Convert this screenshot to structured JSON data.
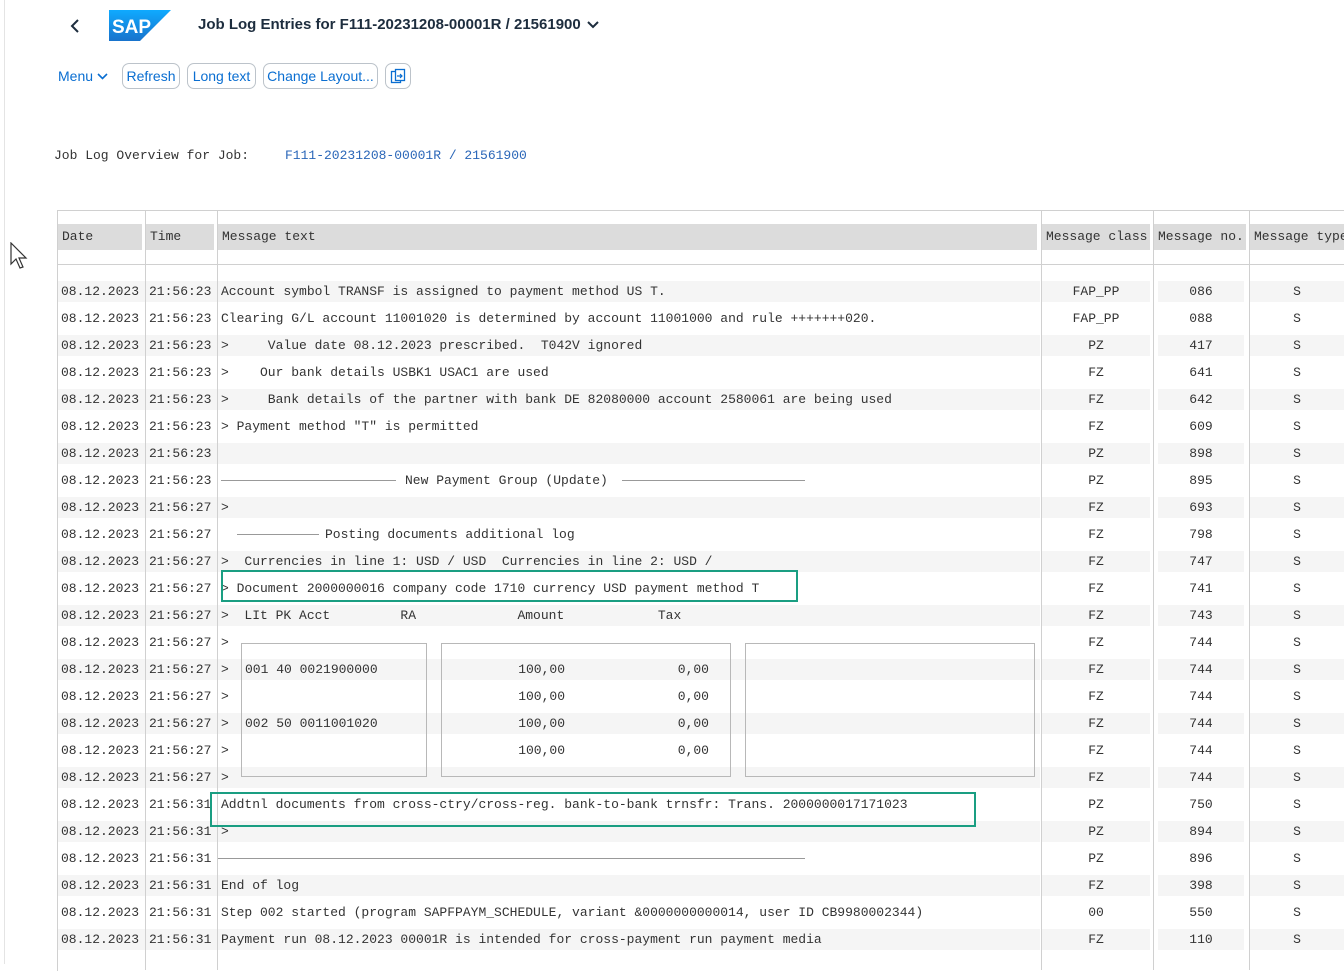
{
  "header": {
    "title": "Job Log Entries for F111-20231208-00001R / 21561900",
    "logo_text": "SAP"
  },
  "toolbar": {
    "menu_label": "Menu",
    "refresh_label": "Refresh",
    "long_text_label": "Long text",
    "change_layout_label": "Change Layout...",
    "export_icon": "share-icon"
  },
  "overview": {
    "label": "Job Log Overview for Job:",
    "value": "F111-20231208-00001R / 21561900"
  },
  "columns": [
    "Date",
    "Time",
    "Message text",
    "Message class",
    "Message no.",
    "Message type"
  ],
  "rows": [
    {
      "date": "08.12.2023",
      "time": "21:56:23",
      "text": "Account symbol TRANSF is assigned to payment method US T.",
      "cls": "FAP_PP",
      "no": "086",
      "type": "S"
    },
    {
      "date": "08.12.2023",
      "time": "21:56:23",
      "text": "Clearing G/L account 11001020 is determined by account 11001000 and rule +++++++020.",
      "cls": "FAP_PP",
      "no": "088",
      "type": "S"
    },
    {
      "date": "08.12.2023",
      "time": "21:56:23",
      "text": ">     Value date 08.12.2023 prescribed.  T042V ignored",
      "cls": "PZ",
      "no": "417",
      "type": "S"
    },
    {
      "date": "08.12.2023",
      "time": "21:56:23",
      "text": ">    Our bank details USBK1 USAC1 are used",
      "cls": "FZ",
      "no": "641",
      "type": "S"
    },
    {
      "date": "08.12.2023",
      "time": "21:56:23",
      "text": ">     Bank details of the partner with bank DE 82080000 account 2580061 are being used",
      "cls": "FZ",
      "no": "642",
      "type": "S"
    },
    {
      "date": "08.12.2023",
      "time": "21:56:23",
      "text": "> Payment method \"T\" is permitted",
      "cls": "FZ",
      "no": "609",
      "type": "S"
    },
    {
      "date": "08.12.2023",
      "time": "21:56:23",
      "text": "",
      "cls": "PZ",
      "no": "898",
      "type": "S"
    },
    {
      "date": "08.12.2023",
      "time": "21:56:23",
      "text": "New Payment Group (Update)",
      "cls": "PZ",
      "no": "895",
      "type": "S"
    },
    {
      "date": "08.12.2023",
      "time": "21:56:27",
      "text": ">",
      "cls": "FZ",
      "no": "693",
      "type": "S"
    },
    {
      "date": "08.12.2023",
      "time": "21:56:27",
      "text": "Posting documents additional log",
      "cls": "FZ",
      "no": "798",
      "type": "S"
    },
    {
      "date": "08.12.2023",
      "time": "21:56:27",
      "text": ">  Currencies in line 1: USD / USD  Currencies in line 2: USD /",
      "cls": "FZ",
      "no": "747",
      "type": "S"
    },
    {
      "date": "08.12.2023",
      "time": "21:56:27",
      "text": "> Document 2000000016 company code 1710 currency USD payment method T",
      "cls": "FZ",
      "no": "741",
      "type": "S"
    },
    {
      "date": "08.12.2023",
      "time": "21:56:27",
      "text": ">  LIt PK Acct         RA             Amount            Tax",
      "cls": "FZ",
      "no": "743",
      "type": "S"
    },
    {
      "date": "08.12.2023",
      "time": "21:56:27",
      "text": ">",
      "cls": "FZ",
      "no": "744",
      "type": "S"
    },
    {
      "date": "08.12.2023",
      "time": "21:56:27",
      "text": ">",
      "cls": "FZ",
      "no": "744",
      "type": "S"
    },
    {
      "date": "08.12.2023",
      "time": "21:56:27",
      "text": ">",
      "cls": "FZ",
      "no": "744",
      "type": "S"
    },
    {
      "date": "08.12.2023",
      "time": "21:56:27",
      "text": ">",
      "cls": "FZ",
      "no": "744",
      "type": "S"
    },
    {
      "date": "08.12.2023",
      "time": "21:56:27",
      "text": ">",
      "cls": "FZ",
      "no": "744",
      "type": "S"
    },
    {
      "date": "08.12.2023",
      "time": "21:56:27",
      "text": ">",
      "cls": "FZ",
      "no": "744",
      "type": "S"
    },
    {
      "date": "08.12.2023",
      "time": "21:56:31",
      "text": "Addtnl documents from cross-ctry/cross-reg. bank-to-bank trnsfr: Trans. 2000000017171023",
      "cls": "PZ",
      "no": "750",
      "type": "S"
    },
    {
      "date": "08.12.2023",
      "time": "21:56:31",
      "text": ">",
      "cls": "PZ",
      "no": "894",
      "type": "S"
    },
    {
      "date": "08.12.2023",
      "time": "21:56:31",
      "text": "",
      "cls": "PZ",
      "no": "896",
      "type": "S"
    },
    {
      "date": "08.12.2023",
      "time": "21:56:31",
      "text": "End of log",
      "cls": "FZ",
      "no": "398",
      "type": "S"
    },
    {
      "date": "08.12.2023",
      "time": "21:56:31",
      "text": "Step 002 started (program SAPFPAYM_SCHEDULE, variant &0000000000014, user ID CB9980002344)",
      "cls": "00",
      "no": "550",
      "type": "S"
    },
    {
      "date": "08.12.2023",
      "time": "21:56:31",
      "text": "Payment run 08.12.2023 00001R is intended for cross-payment run payment media",
      "cls": "FZ",
      "no": "110",
      "type": "S"
    }
  ],
  "line_items": [
    {
      "acct": "001 40 0021900000",
      "amount": "100,00",
      "tax": "0,00"
    },
    {
      "acct": "",
      "amount": "100,00",
      "tax": "0,00"
    },
    {
      "acct": "002 50 0011001020",
      "amount": "100,00",
      "tax": "0,00"
    },
    {
      "acct": "",
      "amount": "100,00",
      "tax": "0,00"
    }
  ],
  "colors": {
    "accent": "#0a6ed1",
    "highlight": "#1a9e82",
    "link": "#2a66b8"
  }
}
